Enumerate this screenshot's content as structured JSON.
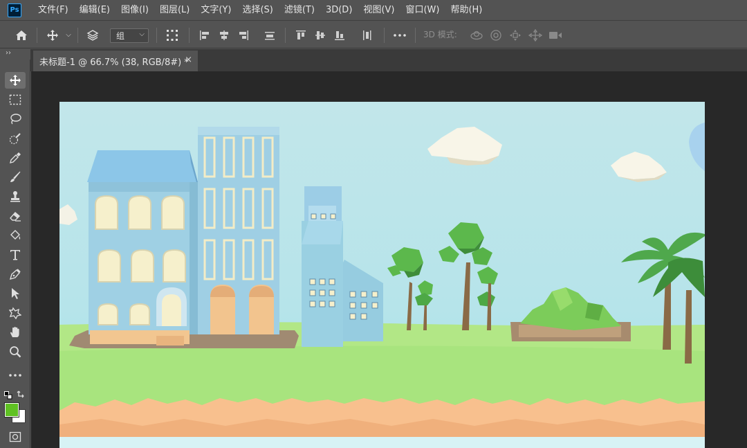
{
  "app": {
    "logo": "Ps"
  },
  "menu": [
    "文件(F)",
    "编辑(E)",
    "图像(I)",
    "图层(L)",
    "文字(Y)",
    "选择(S)",
    "滤镜(T)",
    "3D(D)",
    "视图(V)",
    "窗口(W)",
    "帮助(H)"
  ],
  "options": {
    "auto_select_value": "组",
    "mode_label": "3D 模式:",
    "icons": [
      "home-icon",
      "move-icon",
      "layers-select-icon",
      "transform-controls-icon",
      "align-left-icon",
      "align-hcenter-icon",
      "align-right-icon",
      "distribute-horizontal-icon",
      "align-top-icon",
      "align-vcenter-icon",
      "align-bottom-icon",
      "distribute-vertical-icon",
      "more-icon",
      "orbit-3d-icon",
      "roll-3d-icon",
      "pan-3d-icon",
      "slide-3d-icon",
      "scale-3d-icon"
    ]
  },
  "document": {
    "tab_title": "未标题-1 @ 66.7% (38, RGB/8#) *",
    "close_glyph": "×"
  },
  "toolbar": {
    "collapse_glyph": "››",
    "tools": [
      "move-tool",
      "marquee-tool",
      "lasso-tool",
      "quick-select-tool",
      "eyedropper-tool",
      "brush-tool",
      "stamp-tool",
      "eraser-tool",
      "paint-bucket-tool",
      "type-tool",
      "pen-tool",
      "path-select-tool",
      "shape-tool",
      "hand-tool",
      "zoom-tool",
      "more-tools",
      "swap-colors",
      "color-swatches",
      "quick-mask"
    ],
    "foreground_color": "#5fc123",
    "background_color": "#ffffff"
  },
  "colors": {
    "ui_bg": "#535353",
    "workspace": "#282828",
    "accent": "#31a8ff",
    "sky": "#b9e5ea",
    "grass": "#9fe07a",
    "building_blue": "#9ccfe3",
    "rocks": "#f8c08e"
  }
}
